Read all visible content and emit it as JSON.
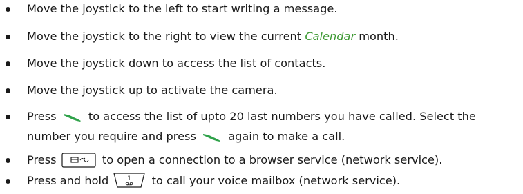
{
  "colors": {
    "text": "#1a1a1a",
    "emphasis": "#3f9a35",
    "call_key": "#2fa24a"
  },
  "items": [
    {
      "text": "Move the joystick to the left to start writing a message."
    },
    {
      "before": "Move the joystick to the right to view the current ",
      "emphasis": "Calendar",
      "after": " month."
    },
    {
      "text": "Move the joystick down to access the list of contacts."
    },
    {
      "text": "Move the joystick up to activate the camera."
    },
    {
      "before": "Press ",
      "icon": "call-key-icon",
      "middle": " to access the list of upto 20 last numbers you have called. Select the",
      "line2_before": "number you require and press ",
      "icon2": "call-key-icon",
      "line2_after": " again to make a call."
    },
    {
      "before": "Press ",
      "icon": "browser-key-icon",
      "after": " to open a connection to a browser service (network service)."
    },
    {
      "before": "Press and hold ",
      "icon": "voicemail-key-icon",
      "after": " to call your voice mailbox (network service)."
    }
  ]
}
